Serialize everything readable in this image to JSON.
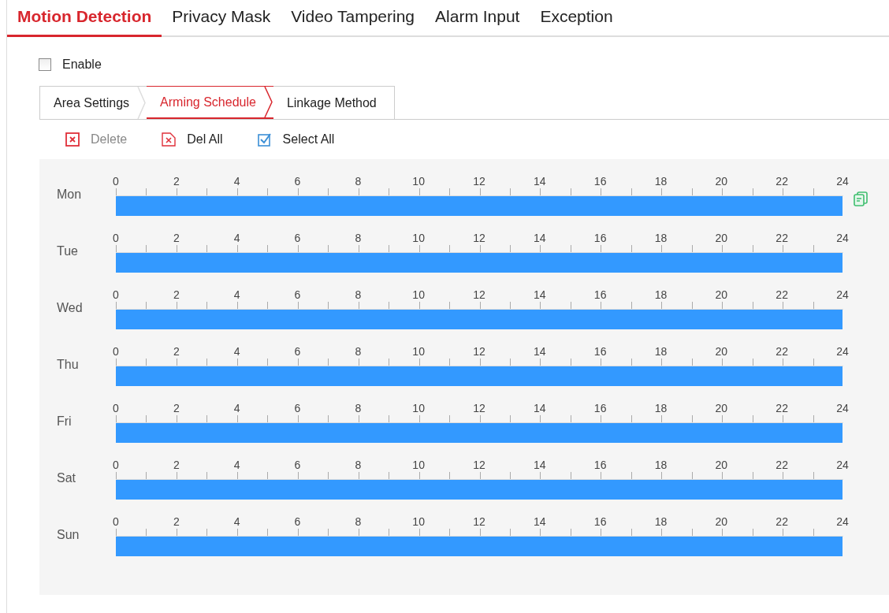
{
  "tabs": [
    {
      "label": "Motion Detection",
      "selected": true
    },
    {
      "label": "Privacy Mask",
      "selected": false
    },
    {
      "label": "Video Tampering",
      "selected": false
    },
    {
      "label": "Alarm Input",
      "selected": false
    },
    {
      "label": "Exception",
      "selected": false
    }
  ],
  "enable": {
    "label": "Enable",
    "checked": false
  },
  "sub_tabs": [
    {
      "label": "Area Settings",
      "selected": false
    },
    {
      "label": "Arming Schedule",
      "selected": true
    },
    {
      "label": "Linkage Method",
      "selected": false
    }
  ],
  "toolbar": [
    {
      "kind": "delete",
      "label": "Delete",
      "disabled": true
    },
    {
      "kind": "delete_all",
      "label": "Del All",
      "disabled": false
    },
    {
      "kind": "select_all",
      "label": "Select All",
      "disabled": false
    }
  ],
  "schedule": [
    {
      "day": "Mon",
      "hours": [
        "0",
        "2",
        "4",
        "6",
        "8",
        "10",
        "12",
        "14",
        "16",
        "18",
        "20",
        "22",
        "24"
      ],
      "level": 1,
      "copy": true
    },
    {
      "day": "Tue",
      "hours": [
        "0",
        "2",
        "4",
        "6",
        "8",
        "10",
        "12",
        "14",
        "16",
        "18",
        "20",
        "22",
        "24"
      ],
      "level": 1,
      "copy": false
    },
    {
      "day": "Wed",
      "hours": [
        "0",
        "2",
        "4",
        "6",
        "8",
        "10",
        "12",
        "14",
        "16",
        "18",
        "20",
        "22",
        "24"
      ],
      "level": 1,
      "copy": false
    },
    {
      "day": "Thu",
      "hours": [
        "0",
        "2",
        "4",
        "6",
        "8",
        "10",
        "12",
        "14",
        "16",
        "18",
        "20",
        "22",
        "24"
      ],
      "level": 1,
      "copy": false
    },
    {
      "day": "Fri",
      "hours": [
        "0",
        "2",
        "4",
        "6",
        "8",
        "10",
        "12",
        "14",
        "16",
        "18",
        "20",
        "22",
        "24"
      ],
      "level": 1,
      "copy": false
    },
    {
      "day": "Sat",
      "hours": [
        "0",
        "2",
        "4",
        "6",
        "8",
        "10",
        "12",
        "14",
        "16",
        "18",
        "20",
        "22",
        "24"
      ],
      "level": 1,
      "copy": false
    },
    {
      "day": "Sun",
      "hours": [
        "0",
        "2",
        "4",
        "6",
        "8",
        "10",
        "12",
        "14",
        "16",
        "18",
        "20",
        "22",
        "24"
      ],
      "level": 1,
      "copy": false
    }
  ]
}
